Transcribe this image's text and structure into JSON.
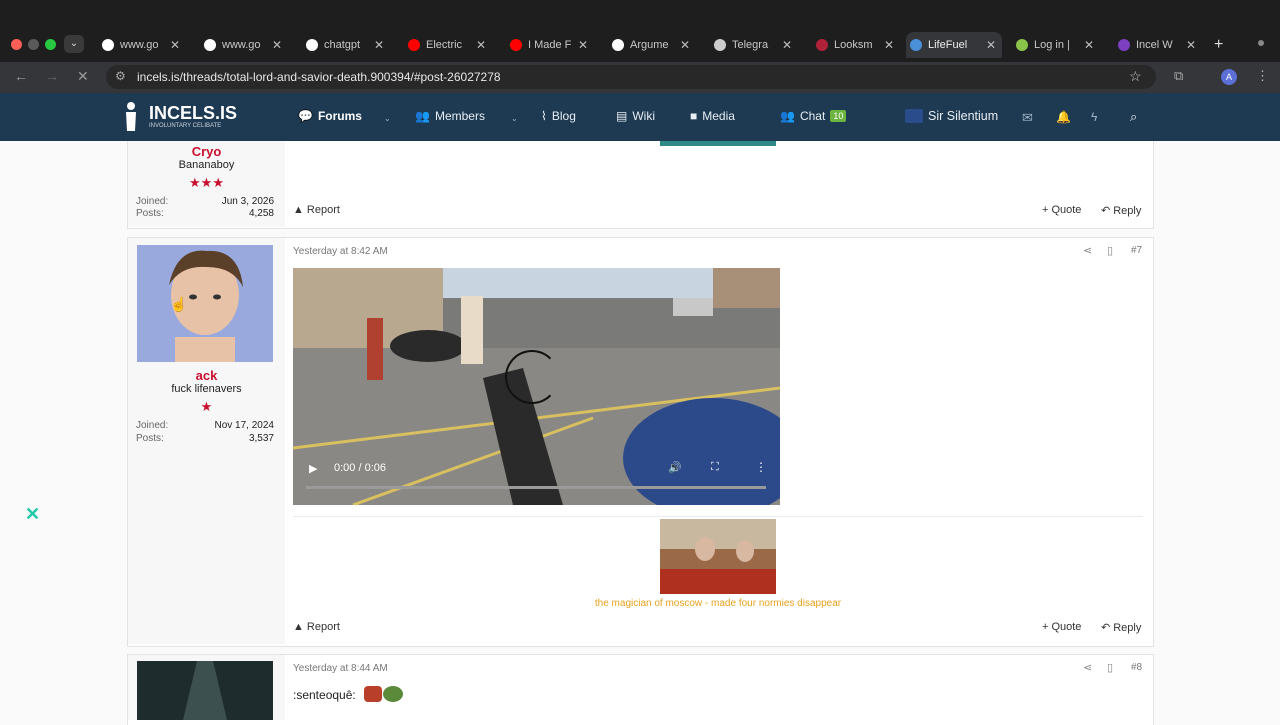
{
  "browser": {
    "tabs": [
      {
        "label": "www.go",
        "icon": "google-icon",
        "color": "#ffffff"
      },
      {
        "label": "www.go",
        "icon": "google-icon",
        "color": "#ffffff"
      },
      {
        "label": "chatgpt",
        "icon": "openai-icon",
        "color": "#ffffff"
      },
      {
        "label": "Electric",
        "icon": "youtube-icon",
        "color": "#ff0000"
      },
      {
        "label": "I Made F",
        "icon": "youtube-icon",
        "color": "#ff0000"
      },
      {
        "label": "Argume",
        "icon": "openai-icon",
        "color": "#ffffff"
      },
      {
        "label": "Telegra",
        "icon": "globe-icon",
        "color": "#cccccc"
      },
      {
        "label": "Looksm",
        "icon": "looksmax-icon",
        "color": "#b0213a"
      },
      {
        "label": "LifeFuel",
        "icon": "incels-icon",
        "color": "#4a90d9"
      },
      {
        "label": "Log in |",
        "icon": "leaf-icon",
        "color": "#8bc34a"
      },
      {
        "label": "Incel W",
        "icon": "incels-icon",
        "color": "#7b3fbf"
      }
    ],
    "url": "incels.is/threads/total-lord-and-savior-death.900394/#post-26027278",
    "avatar_initial": "A"
  },
  "site": {
    "logo_main": "INCELS.IS",
    "logo_sub": "INVOLUNTARY CELIBATE",
    "nav": {
      "forums": "Forums",
      "members": "Members",
      "blog": "Blog",
      "wiki": "Wiki",
      "media": "Media",
      "chat": "Chat",
      "chat_badge": "10",
      "user": "Sir Silentium"
    }
  },
  "posts": [
    {
      "username": "Cryo",
      "user_title": "Bananaboy",
      "stars": "★★★",
      "joined_label": "Joined:",
      "joined": "Jun 3, 2026",
      "posts_label": "Posts:",
      "posts": "4,258",
      "report": "Report",
      "quote": "Quote",
      "reply": "Reply"
    },
    {
      "username": "ack",
      "user_title": "fuck lifenavers",
      "stars": "★",
      "joined_label": "Joined:",
      "joined": "Nov 17, 2024",
      "posts_label": "Posts:",
      "posts": "3,537",
      "timestamp": "Yesterday at 8:42 AM",
      "number": "#7",
      "video_time": "0:00 / 0:06",
      "caption": "the magician of moscow - made four normies disappear",
      "report": "Report",
      "quote": "Quote",
      "reply": "Reply"
    },
    {
      "timestamp": "Yesterday at 8:44 AM",
      "number": "#8",
      "text": ":senteoquê:"
    }
  ],
  "colors": {
    "header": "#1e3a52",
    "username": "#c8102e",
    "caption": "#e6a11e",
    "chat_badge": "#6db33f"
  }
}
